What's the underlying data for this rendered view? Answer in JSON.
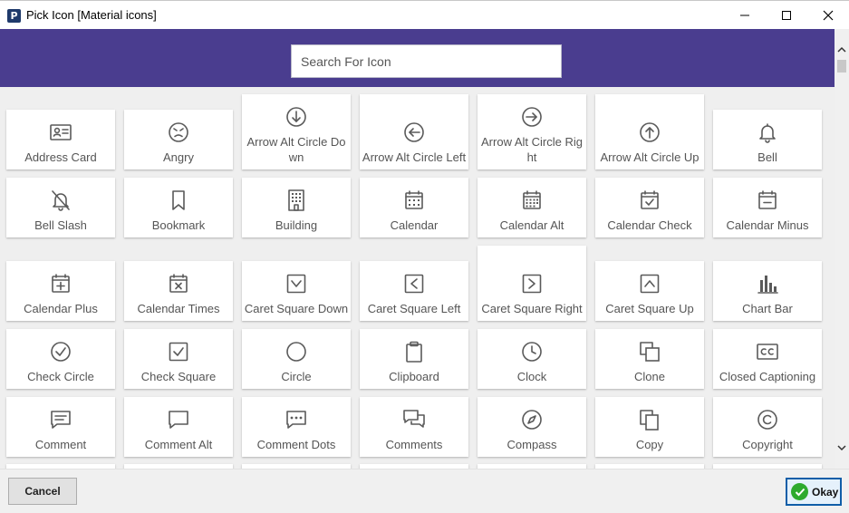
{
  "window": {
    "title": "Pick Icon [Material icons]",
    "app_icon_letter": "P"
  },
  "search": {
    "placeholder": "Search For Icon",
    "value": ""
  },
  "colors": {
    "header": "#4a3d8f",
    "icon": "#5a5a5a",
    "okay_check": "#2eaa2e"
  },
  "icons": [
    {
      "label": "Address Card",
      "icon": "address-card-icon"
    },
    {
      "label": "Angry",
      "icon": "angry-icon"
    },
    {
      "label": "Arrow Alt Circle Down",
      "icon": "arrow-circle-down-icon"
    },
    {
      "label": "Arrow Alt Circle Left",
      "icon": "arrow-circle-left-icon"
    },
    {
      "label": "Arrow Alt Circle Right",
      "icon": "arrow-circle-right-icon"
    },
    {
      "label": "Arrow Alt Circle Up",
      "icon": "arrow-circle-up-icon"
    },
    {
      "label": "Bell",
      "icon": "bell-icon"
    },
    {
      "label": "Bell Slash",
      "icon": "bell-slash-icon"
    },
    {
      "label": "Bookmark",
      "icon": "bookmark-icon"
    },
    {
      "label": "Building",
      "icon": "building-icon"
    },
    {
      "label": "Calendar",
      "icon": "calendar-icon"
    },
    {
      "label": "Calendar Alt",
      "icon": "calendar-alt-icon"
    },
    {
      "label": "Calendar Check",
      "icon": "calendar-check-icon"
    },
    {
      "label": "Calendar Minus",
      "icon": "calendar-minus-icon"
    },
    {
      "label": "Calendar Plus",
      "icon": "calendar-plus-icon"
    },
    {
      "label": "Calendar Times",
      "icon": "calendar-times-icon"
    },
    {
      "label": "Caret Square Down",
      "icon": "caret-square-down-icon"
    },
    {
      "label": "Caret Square Left",
      "icon": "caret-square-left-icon"
    },
    {
      "label": "Caret Square Right",
      "icon": "caret-square-right-icon"
    },
    {
      "label": "Caret Square Up",
      "icon": "caret-square-up-icon"
    },
    {
      "label": "Chart Bar",
      "icon": "chart-bar-icon"
    },
    {
      "label": "Check Circle",
      "icon": "check-circle-icon"
    },
    {
      "label": "Check Square",
      "icon": "check-square-icon"
    },
    {
      "label": "Circle",
      "icon": "circle-icon"
    },
    {
      "label": "Clipboard",
      "icon": "clipboard-icon"
    },
    {
      "label": "Clock",
      "icon": "clock-icon"
    },
    {
      "label": "Clone",
      "icon": "clone-icon"
    },
    {
      "label": "Closed Captioning",
      "icon": "closed-captioning-icon"
    },
    {
      "label": "Comment",
      "icon": "comment-icon"
    },
    {
      "label": "Comment Alt",
      "icon": "comment-alt-icon"
    },
    {
      "label": "Comment Dots",
      "icon": "comment-dots-icon"
    },
    {
      "label": "Comments",
      "icon": "comments-icon"
    },
    {
      "label": "Compass",
      "icon": "compass-icon"
    },
    {
      "label": "Copy",
      "icon": "copy-icon"
    },
    {
      "label": "Copyright",
      "icon": "copyright-icon"
    }
  ],
  "footer": {
    "cancel_label": "Cancel",
    "okay_label": "Okay"
  }
}
